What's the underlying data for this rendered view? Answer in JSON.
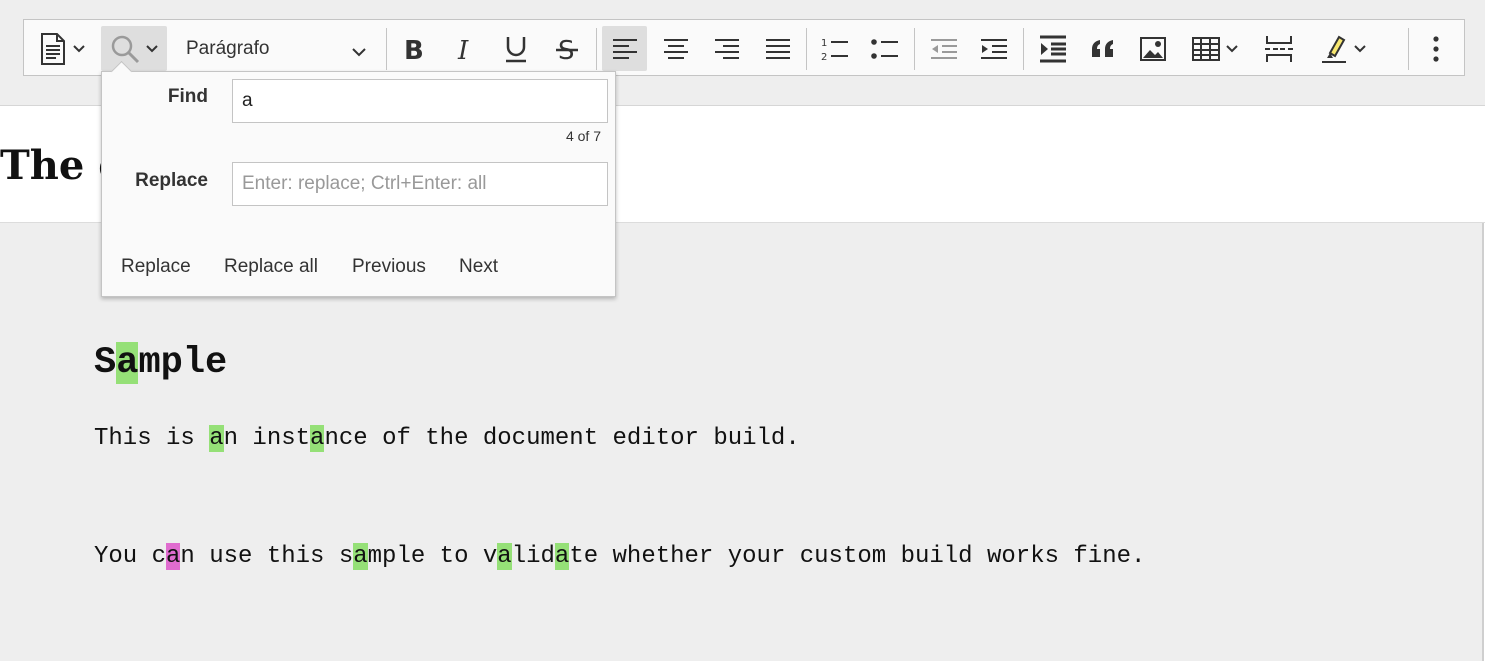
{
  "toolbar": {
    "heading_value": "Parágrafo",
    "icons": [
      "document-icon",
      "search-icon",
      "bold-icon",
      "italic-icon",
      "underline-icon",
      "strikethrough-icon",
      "align-left-icon",
      "align-center-icon",
      "align-right-icon",
      "align-justify-icon",
      "numbered-list-icon",
      "bulleted-list-icon",
      "outdent-icon",
      "indent-icon",
      "block-indent-icon",
      "blockquote-icon",
      "image-icon",
      "table-icon",
      "page-break-icon",
      "highlight-icon",
      "more-icon"
    ]
  },
  "document": {
    "title_visible": "The c",
    "heading_parts": [
      "S",
      "a",
      "mple"
    ],
    "para1_parts": [
      "This is ",
      "a",
      "n inst",
      "a",
      "nce of the document editor build."
    ],
    "para2_parts": [
      "You c",
      "a",
      "n use this s",
      "a",
      "mple to v",
      "a",
      "lid",
      "a",
      "te whether your custom build works fine."
    ]
  },
  "find_replace": {
    "find_label": "Find",
    "find_value": "a",
    "counter": "4 of 7",
    "replace_label": "Replace",
    "replace_placeholder": "Enter: replace; Ctrl+Enter: all",
    "buttons": {
      "replace": "Replace",
      "replace_all": "Replace all",
      "previous": "Previous",
      "next": "Next"
    }
  },
  "colors": {
    "match_highlight": "#95e077",
    "current_match_highlight": "#e06ccf",
    "toolbar_bg": "#fafafa",
    "canvas_bg": "#eeeeee"
  }
}
